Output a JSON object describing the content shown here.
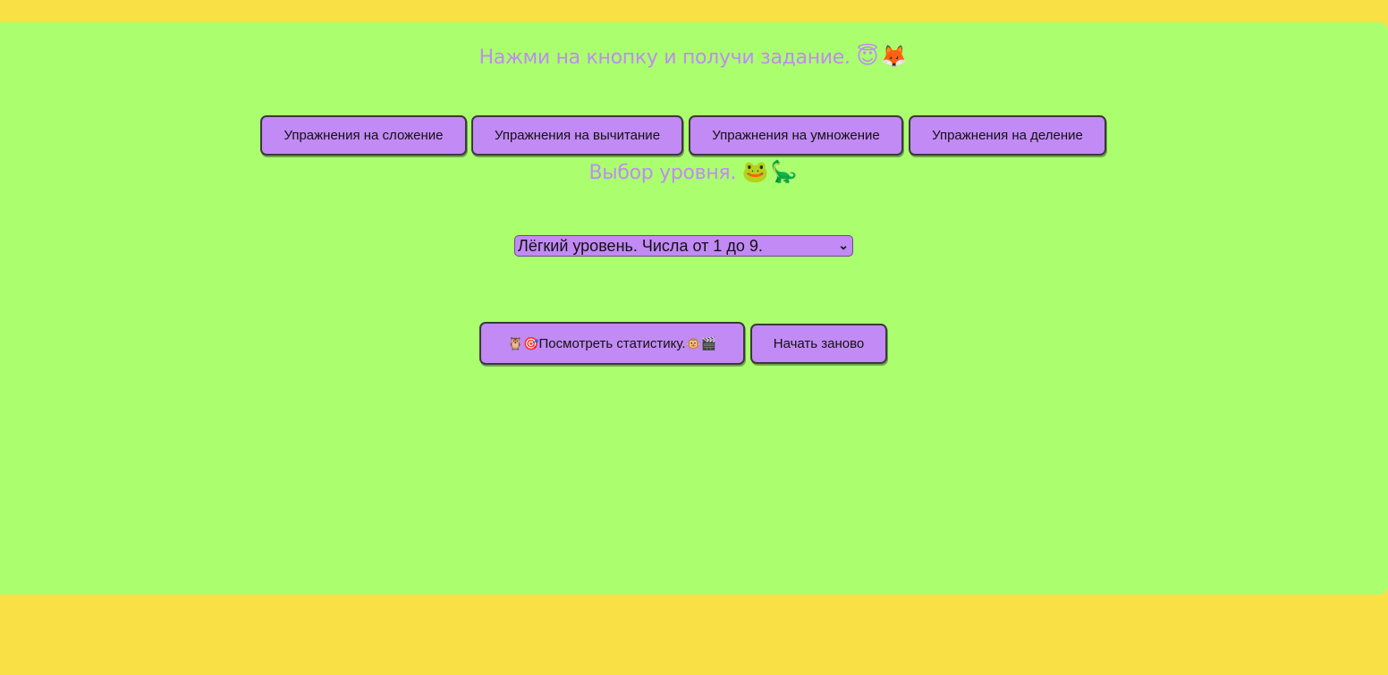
{
  "header": {
    "task_prompt": "Нажми на кнопку и получи задание.",
    "task_emojis": "😇🦊"
  },
  "exercises": {
    "addition_label": "Упражнения на сложение",
    "subtraction_label": "Упражнения на вычитание",
    "multiplication_label": "Упражнения на умножение",
    "division_label": "Упражнения на деление"
  },
  "level": {
    "heading": "Выбор уровня.",
    "heading_emojis": "🐸🦕",
    "selected": "Лёгкий уровень. Числа от 1 до 9."
  },
  "actions": {
    "stats_prefix_emojis": "🦉🎯",
    "stats_label": "Посмотреть статистику.",
    "stats_suffix_emojis": "🐵🎬",
    "restart_label": "Начать заново"
  },
  "colors": {
    "page_background": "#f9e045",
    "panel_background": "#abff6f",
    "button_background": "#c28af4",
    "heading_text": "#bf8cf2"
  },
  "icons": {
    "select_chevron": "chevron-down-icon"
  }
}
